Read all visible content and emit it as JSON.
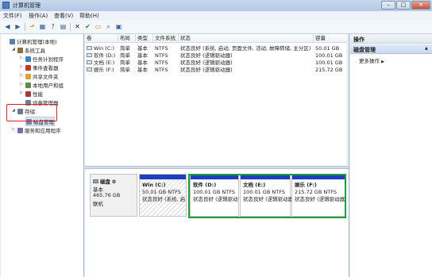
{
  "window": {
    "title": "计算机管理"
  },
  "menu": [
    "文件(F)",
    "操作(A)",
    "查看(V)",
    "帮助(H)"
  ],
  "toolbar": [
    "back-icon",
    "forward-icon",
    "up-icon",
    "tree-icon",
    "help-icon",
    "properties-icon",
    "delete-icon",
    "check-icon",
    "open-icon",
    "search-icon",
    "settings-icon"
  ],
  "tree": [
    {
      "label": "计算机管理(本地)",
      "icon": "computer-management-icon",
      "depth": 0,
      "expander": ""
    },
    {
      "label": "系统工具",
      "icon": "tools-icon",
      "depth": 1,
      "expander": "◢"
    },
    {
      "label": "任务计划程序",
      "icon": "clock-icon",
      "depth": 2,
      "expander": "▷"
    },
    {
      "label": "事件查看器",
      "icon": "event-viewer-icon",
      "depth": 2,
      "expander": "▷"
    },
    {
      "label": "共享文件夹",
      "icon": "folder-icon",
      "depth": 2,
      "expander": "▷"
    },
    {
      "label": "本地用户和组",
      "icon": "users-icon",
      "depth": 2,
      "expander": "▷"
    },
    {
      "label": "性能",
      "icon": "performance-icon",
      "depth": 2,
      "expander": "▷"
    },
    {
      "label": "设备管理器",
      "icon": "device-manager-icon",
      "depth": 2,
      "expander": ""
    },
    {
      "label": "存储",
      "icon": "storage-icon",
      "depth": 1,
      "expander": "◢"
    },
    {
      "label": "磁盘管理",
      "icon": "disk-management-icon",
      "depth": 2,
      "expander": "",
      "selected": true
    },
    {
      "label": "服务和应用程序",
      "icon": "services-icon",
      "depth": 1,
      "expander": "▷"
    }
  ],
  "columns": [
    "卷",
    "布局",
    "类型",
    "文件系统",
    "状态",
    "容量"
  ],
  "volumes": [
    {
      "vol": "Win (C:)",
      "layout": "简单",
      "type": "基本",
      "fs": "NTFS",
      "status": "状态良好 (系统, 启动, 页面文件, 活动, 故障转储, 主分区)",
      "capacity": "50.01 GB"
    },
    {
      "vol": "软件 (D:)",
      "layout": "简单",
      "type": "基本",
      "fs": "NTFS",
      "status": "状态良好 (逻辑驱动器)",
      "capacity": "100.01 GB"
    },
    {
      "vol": "文档 (E:)",
      "layout": "简单",
      "type": "基本",
      "fs": "NTFS",
      "status": "状态良好 (逻辑驱动器)",
      "capacity": "100.01 GB"
    },
    {
      "vol": "娱乐 (F:)",
      "layout": "简单",
      "type": "基本",
      "fs": "NTFS",
      "status": "状态良好 (逻辑驱动器)",
      "capacity": "215.72 GB"
    }
  ],
  "disk": {
    "name": "磁盘 0",
    "type": "基本",
    "size": "465.76 GB",
    "state": "联机"
  },
  "partitions": [
    {
      "name": "Win  (C:)",
      "size": "50.01 GB NTFS",
      "status": "状态良好 (系统, 启"
    },
    {
      "name": "软件  (D:)",
      "size": "100.01 GB NTFS",
      "status": "状态良好 (逻辑驱动"
    },
    {
      "name": "文档  (E:)",
      "size": "100.01 GB NTFS",
      "status": "状态良好 (逻辑驱动器"
    },
    {
      "name": "娱乐  (F:)",
      "size": "215.72 GB NTFS",
      "status": "状态良好 (逻辑驱动器"
    }
  ],
  "actions": {
    "header": "操作",
    "section": "磁盘管理",
    "more": "更多操作"
  },
  "colors": {
    "partition_bar": "#1f3dbf",
    "highlight_red": "#d6202a",
    "highlight_green": "#1f9d3a"
  }
}
